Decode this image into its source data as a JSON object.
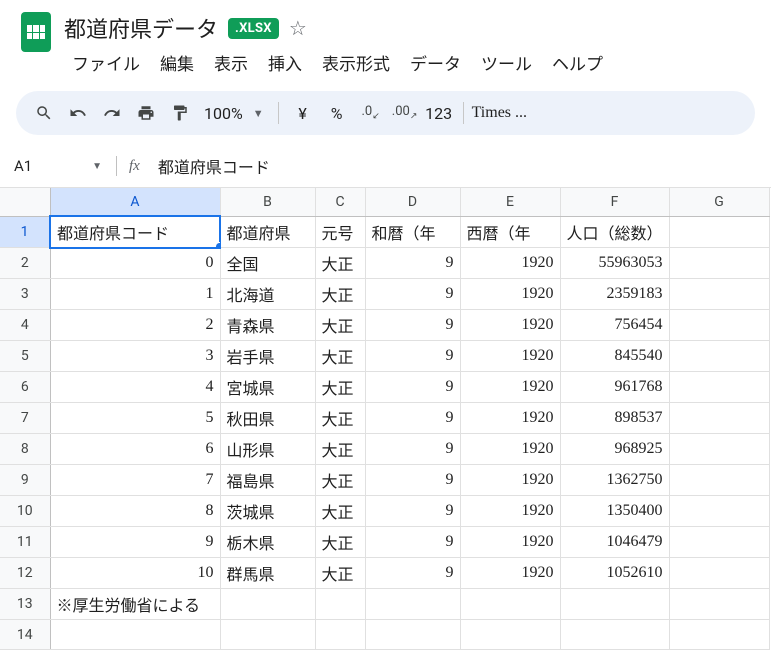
{
  "doc_title": "都道府県データ",
  "xlsx_badge": ".XLSX",
  "star_icon": "☆",
  "menus": [
    "ファイル",
    "編集",
    "表示",
    "挿入",
    "表示形式",
    "データ",
    "ツール",
    "ヘルプ"
  ],
  "toolbar": {
    "zoom": "100%",
    "currency": "¥",
    "percent": "%",
    "dec_dec": ".0",
    "dec_inc": ".00",
    "num_fmt": "123",
    "font": "Times ..."
  },
  "name_box": "A1",
  "fx_label": "fx",
  "formula_value": "都道府県コード",
  "columns": [
    "A",
    "B",
    "C",
    "D",
    "E",
    "F",
    "G"
  ],
  "rows": [
    1,
    2,
    3,
    4,
    5,
    6,
    7,
    8,
    9,
    10,
    11,
    12,
    13,
    14
  ],
  "headers": [
    "都道府県コード",
    "都道府県",
    "元号",
    "和暦（年",
    "西暦（年",
    "人口（総数）"
  ],
  "data_rows": [
    {
      "code": 0,
      "pref": "全国",
      "era": "大正",
      "wa": 9,
      "year": 1920,
      "pop": 55963053
    },
    {
      "code": 1,
      "pref": "北海道",
      "era": "大正",
      "wa": 9,
      "year": 1920,
      "pop": 2359183
    },
    {
      "code": 2,
      "pref": "青森県",
      "era": "大正",
      "wa": 9,
      "year": 1920,
      "pop": 756454
    },
    {
      "code": 3,
      "pref": "岩手県",
      "era": "大正",
      "wa": 9,
      "year": 1920,
      "pop": 845540
    },
    {
      "code": 4,
      "pref": "宮城県",
      "era": "大正",
      "wa": 9,
      "year": 1920,
      "pop": 961768
    },
    {
      "code": 5,
      "pref": "秋田県",
      "era": "大正",
      "wa": 9,
      "year": 1920,
      "pop": 898537
    },
    {
      "code": 6,
      "pref": "山形県",
      "era": "大正",
      "wa": 9,
      "year": 1920,
      "pop": 968925
    },
    {
      "code": 7,
      "pref": "福島県",
      "era": "大正",
      "wa": 9,
      "year": 1920,
      "pop": 1362750
    },
    {
      "code": 8,
      "pref": "茨城県",
      "era": "大正",
      "wa": 9,
      "year": 1920,
      "pop": 1350400
    },
    {
      "code": 9,
      "pref": "栃木県",
      "era": "大正",
      "wa": 9,
      "year": 1920,
      "pop": 1046479
    },
    {
      "code": 10,
      "pref": "群馬県",
      "era": "大正",
      "wa": 9,
      "year": 1920,
      "pop": 1052610
    }
  ],
  "note": "※厚生労働省による"
}
